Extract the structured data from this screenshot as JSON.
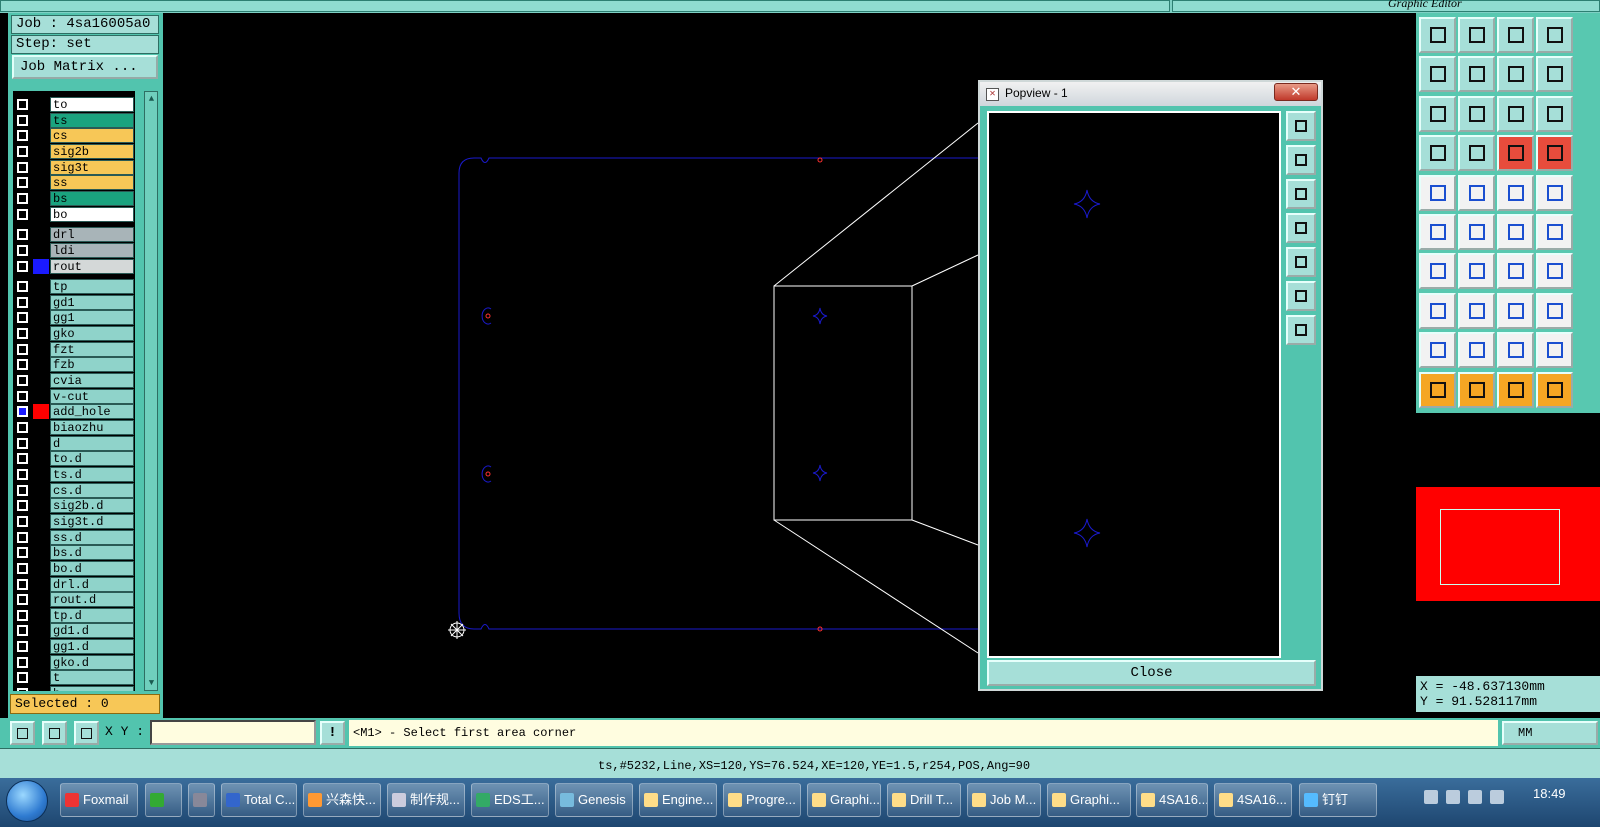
{
  "app": {
    "title": "Graphic Editor"
  },
  "left_panel": {
    "job_label": "Job : 4sa16005a0",
    "step_label": "Step: set",
    "job_matrix_button": "Job Matrix ...",
    "selected_label": "Selected : 0"
  },
  "layers": [
    {
      "name": "to",
      "color": "#ffffff"
    },
    {
      "name": "ts",
      "color": "#1aa37f"
    },
    {
      "name": "cs",
      "color": "#f7c757"
    },
    {
      "name": "sig2b",
      "color": "#f7c757"
    },
    {
      "name": "sig3t",
      "color": "#f7c757"
    },
    {
      "name": "ss",
      "color": "#f7c757"
    },
    {
      "name": "bs",
      "color": "#1aa37f"
    },
    {
      "name": "bo",
      "color": "#ffffff"
    },
    {
      "name": "drl",
      "color": "#a8b4b8"
    },
    {
      "name": "ldi",
      "color": "#a8b4b8"
    },
    {
      "name": "rout",
      "color": "#d4d8d8",
      "swatch": "#1a1aff"
    },
    {
      "name": "tp",
      "color": "#8fd3ca"
    },
    {
      "name": "gd1",
      "color": "#8fd3ca"
    },
    {
      "name": "gg1",
      "color": "#8fd3ca"
    },
    {
      "name": "gko",
      "color": "#8fd3ca"
    },
    {
      "name": "fzt",
      "color": "#8fd3ca"
    },
    {
      "name": "fzb",
      "color": "#8fd3ca"
    },
    {
      "name": "cvia",
      "color": "#8fd3ca"
    },
    {
      "name": "v-cut",
      "color": "#8fd3ca"
    },
    {
      "name": "add_hole",
      "color": "#8fd3ca",
      "swatch": "#ff0000",
      "active": true
    },
    {
      "name": "biaozhu",
      "color": "#8fd3ca"
    },
    {
      "name": "d",
      "color": "#8fd3ca"
    },
    {
      "name": "to.d",
      "color": "#8fd3ca"
    },
    {
      "name": "ts.d",
      "color": "#8fd3ca"
    },
    {
      "name": "cs.d",
      "color": "#8fd3ca"
    },
    {
      "name": "sig2b.d",
      "color": "#8fd3ca"
    },
    {
      "name": "sig3t.d",
      "color": "#8fd3ca"
    },
    {
      "name": "ss.d",
      "color": "#8fd3ca"
    },
    {
      "name": "bs.d",
      "color": "#8fd3ca"
    },
    {
      "name": "bo.d",
      "color": "#8fd3ca"
    },
    {
      "name": "drl.d",
      "color": "#8fd3ca"
    },
    {
      "name": "rout.d",
      "color": "#8fd3ca"
    },
    {
      "name": "tp.d",
      "color": "#8fd3ca"
    },
    {
      "name": "gd1.d",
      "color": "#8fd3ca"
    },
    {
      "name": "gg1.d",
      "color": "#8fd3ca"
    },
    {
      "name": "gko.d",
      "color": "#8fd3ca"
    },
    {
      "name": "t",
      "color": "#8fd3ca"
    },
    {
      "name": "h",
      "color": "#8fd3ca"
    }
  ],
  "popview": {
    "title": "Popview - 1",
    "close_x": "✕",
    "close_button": "Close",
    "icon": "popview-window-icon"
  },
  "command": {
    "xy_label": "X Y :",
    "xy_value": "",
    "excl": "!",
    "prompt": "<M1> - Select first area corner",
    "unit": "MM"
  },
  "coords": {
    "x": "X = -48.637130mm",
    "y": "Y = 91.528117mm"
  },
  "status": {
    "text": "ts,#5232,Line,XS=120,YS=76.524,XE=120,YE=1.5,r254,POS,Ang=90"
  },
  "taskbar": {
    "items": [
      "Foxmail",
      "",
      "",
      "Total C...",
      "兴森快...",
      "制作规...",
      "EDS工...",
      "Genesis",
      "Engine...",
      "Progre...",
      "Graphi...",
      "Drill T...",
      "Job M...",
      "Graphi...",
      "4SA16...",
      "4SA16...",
      "钉钉"
    ],
    "clock": "18:49"
  },
  "icons": {
    "start": "windows-start-icon",
    "cursor": "crosshair-cursor-icon"
  },
  "colors": {
    "panel": "#52c4ae",
    "outline": "#1a1acc",
    "popview_frame": "#ffffff",
    "minimap": "#ff0000"
  }
}
